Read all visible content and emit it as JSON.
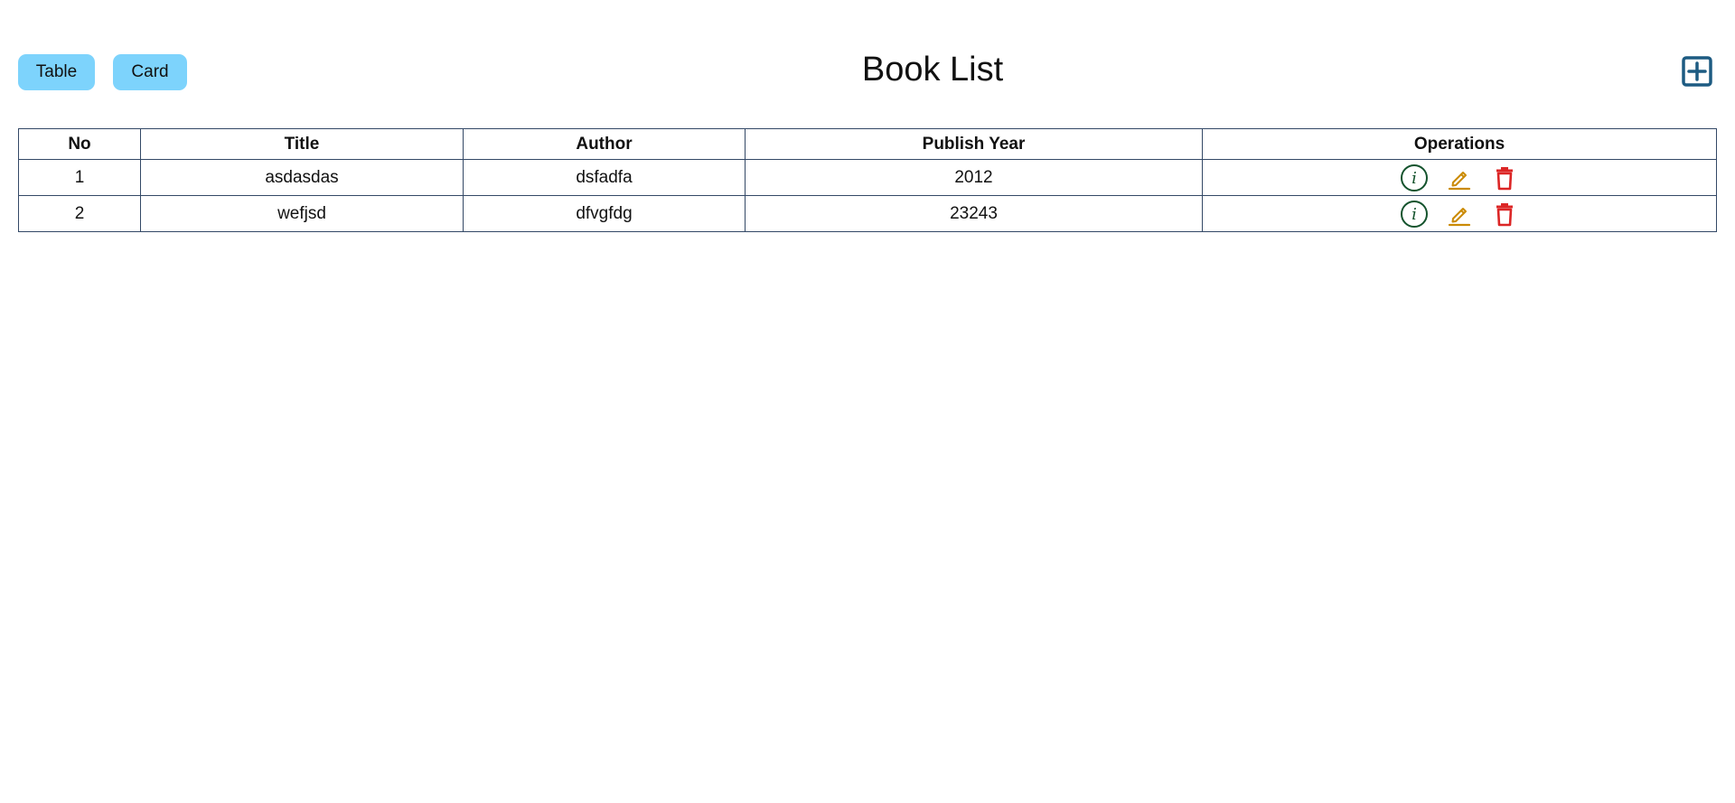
{
  "header": {
    "title": "Book List",
    "toggle_table_label": "Table",
    "toggle_card_label": "Card",
    "add_icon": "plus-square-icon"
  },
  "colors": {
    "toggle_bg": "#7dd3fc",
    "add_icon": "#1d5b82",
    "info_icon": "#14532d",
    "edit_icon": "#ca8a04",
    "delete_icon": "#dc2626",
    "table_border": "#334866"
  },
  "table": {
    "headers": [
      "No",
      "Title",
      "Author",
      "Publish Year",
      "Operations"
    ],
    "rows": [
      {
        "no": "1",
        "title": "asdasdas",
        "author": "dsfadfa",
        "year": "2012"
      },
      {
        "no": "2",
        "title": "wefjsd",
        "author": "dfvgfdg",
        "year": "23243"
      }
    ],
    "operation_icons": [
      "info-circle-icon",
      "pencil-edit-icon",
      "trash-delete-icon"
    ]
  }
}
